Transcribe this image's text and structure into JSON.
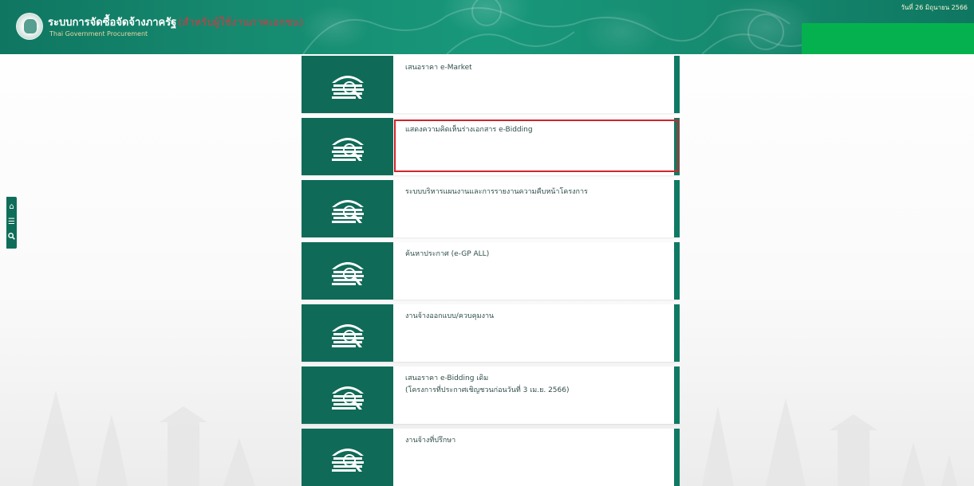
{
  "header": {
    "title": "ระบบการจัดซื้อจัดจ้างภาครัฐ",
    "title_suffix": "(สำหรับผู้ใช้งานภาคเอกชน)",
    "subtitle": "Thai Government Procurement",
    "date": "วันที่ 26 มิถุนายน 2566"
  },
  "side_tools": {
    "home_icon": "home-icon",
    "menu_icon": "menu-icon",
    "search_icon": "search-icon"
  },
  "menu": {
    "items": [
      {
        "label": "เสนอราคา e-Market"
      },
      {
        "label": "แสดงความคิดเห็นร่างเอกสาร e-Bidding"
      },
      {
        "label": "ระบบบริหารแผนงานและการรายงานความคืบหน้าโครงการ"
      },
      {
        "label": "ค้นหาประกาศ (e-GP ALL)"
      },
      {
        "label": "งานจ้างออกแบบ/ควบคุมงาน"
      },
      {
        "label": "เสนอราคา e-Bidding เดิม\n(โครงการที่ประกาศเชิญชวนก่อนวันที่ 3 เม.ย. 2566)"
      },
      {
        "label": "งานจ้างที่ปรึกษา"
      }
    ]
  },
  "colors": {
    "header_green": "#0f7661",
    "icon_box_green": "#0f6b58",
    "highlight_red": "#d1232a",
    "overlay_green": "#04b14e"
  }
}
